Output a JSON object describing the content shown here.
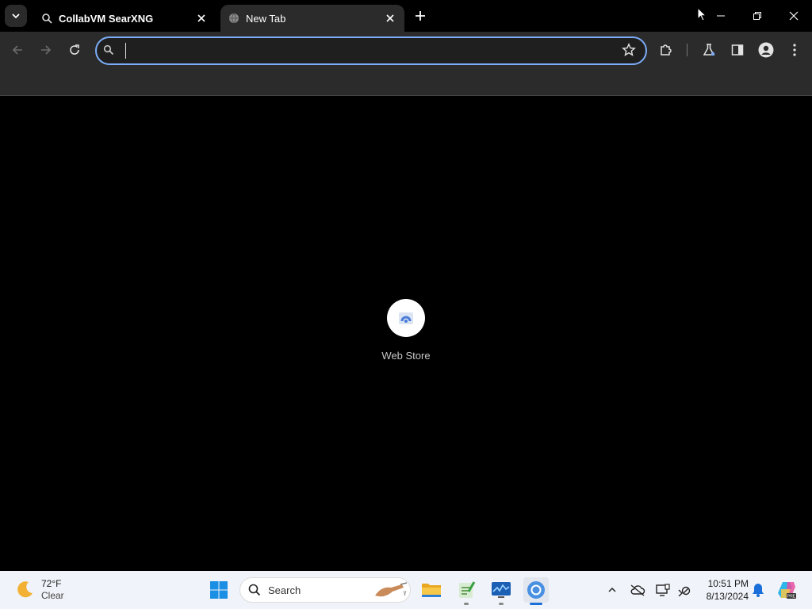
{
  "browser": {
    "tabs": [
      {
        "title": "CollabVM SearXNG",
        "active": false
      },
      {
        "title": "New Tab",
        "active": true
      }
    ],
    "omnibox": {
      "value": "",
      "placeholder": ""
    }
  },
  "newtab": {
    "shortcuts": [
      {
        "label": "Web Store"
      }
    ]
  },
  "taskbar": {
    "weather": {
      "temp": "72°F",
      "condition": "Clear"
    },
    "search": {
      "placeholder": "Search"
    },
    "clock": {
      "time": "10:51 PM",
      "date": "8/13/2024"
    }
  },
  "colors": {
    "accent": "#7cacf8",
    "tab_active": "#2b2b2b",
    "taskbar": "#f0f3f9"
  }
}
